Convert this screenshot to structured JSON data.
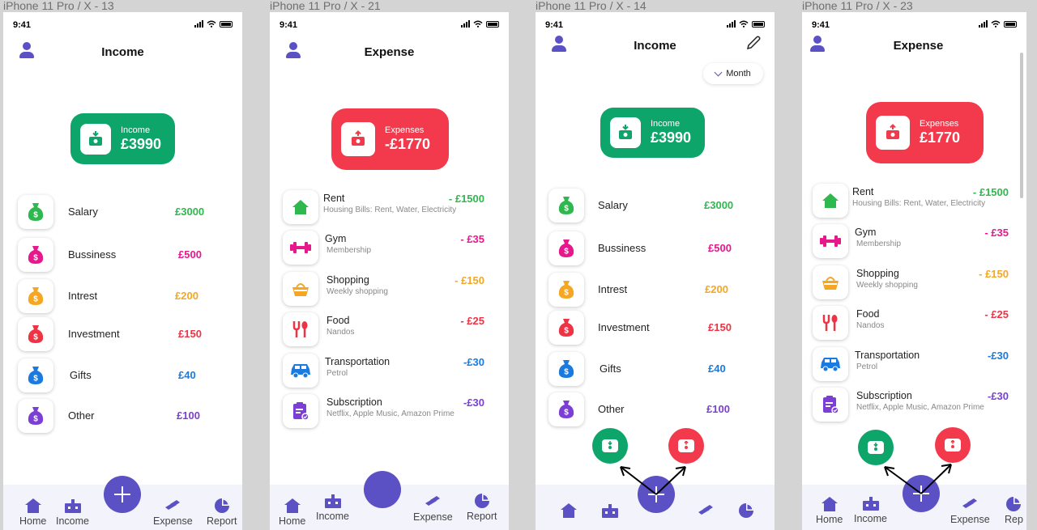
{
  "frames": [
    {
      "label": "iPhone 11 Pro / X - 13"
    },
    {
      "label": "iPhone 11 Pro / X - 21"
    },
    {
      "label": "iPhone 11 Pro / X - 14"
    },
    {
      "label": "iPhone 11 Pro / X - 23"
    }
  ],
  "status": {
    "time": "9:41"
  },
  "colors": {
    "accent": "#5b50c4",
    "income_green": "#0ea56b",
    "expense_red": "#f23a4c"
  },
  "income_screen": {
    "title": "Income",
    "summary_label": "Income",
    "summary_value": "£3990",
    "items": [
      {
        "label": "Salary",
        "amount": "£3000",
        "color": "#2fb84e",
        "icon": "money-bag-icon"
      },
      {
        "label": "Bussiness",
        "amount": "£500",
        "color": "#e6188c",
        "icon": "money-bag-icon"
      },
      {
        "label": "Intrest",
        "amount": "£200",
        "color": "#f5a623",
        "icon": "money-bag-icon"
      },
      {
        "label": "Investment",
        "amount": "£150",
        "color": "#ee3344",
        "icon": "money-bag-icon"
      },
      {
        "label": "Gifts",
        "amount": "£40",
        "color": "#1a7ae0",
        "icon": "money-bag-icon"
      },
      {
        "label": "Other",
        "amount": "£100",
        "color": "#7b3fd6",
        "icon": "money-bag-icon"
      }
    ]
  },
  "expense_screen": {
    "title": "Expense",
    "summary_label": "Expenses",
    "summary_value_signed": "-£1770",
    "summary_value": "£1770",
    "items": [
      {
        "label": "Rent",
        "sub": "Housing Bills: Rent, Water, Electricity",
        "amount": "- £1500",
        "color": "#2fb84e",
        "icon": "house-icon"
      },
      {
        "label": "Gym",
        "sub": "Membership",
        "amount": "- £35",
        "color": "#e6188c",
        "icon": "dumbbell-icon"
      },
      {
        "label": "Shopping",
        "sub": "Weekly shopping",
        "amount": "- £150",
        "color": "#f5a623",
        "icon": "basket-icon"
      },
      {
        "label": "Food",
        "sub": "Nandos",
        "amount": "- £25",
        "color": "#ee3344",
        "icon": "cutlery-icon"
      },
      {
        "label": "Transportation",
        "sub": "Petrol",
        "amount": "-£30",
        "color": "#1a7ae0",
        "icon": "car-icon"
      },
      {
        "label": "Subscription",
        "sub": "Netflix, Apple Music, Amazon Prime",
        "amount": "-£30",
        "color": "#7b3fd6",
        "icon": "clipboard-icon"
      }
    ]
  },
  "month_filter": {
    "label": "Month"
  },
  "nav": {
    "home": "Home",
    "income": "Income",
    "expense": "Expense",
    "report": "Report",
    "report_clipped": "Rep"
  }
}
